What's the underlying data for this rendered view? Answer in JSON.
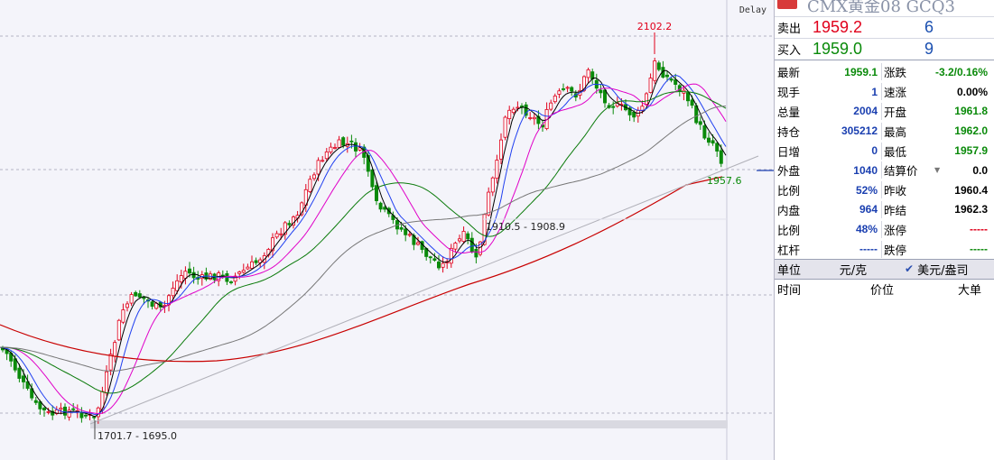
{
  "chart": {
    "delay_label": "Delay",
    "high_label": "2102.2",
    "current_label": "1957.6",
    "mid_range_label": "1910.5 - 1908.9",
    "low_range_label": "1701.7 - 1695.0",
    "colors": {
      "up": "#e0001b",
      "down": "#0a8a0a",
      "ma5": "#000000",
      "ma10": "#1f3ff0",
      "ma20": "#e000c8",
      "ma60": "#0a7a0a",
      "ma120": "#777777",
      "ma250": "#c80000"
    }
  },
  "quote": {
    "title": "CMX黄金08  GCQ3",
    "sell": {
      "label": "卖出",
      "price": "1959.2",
      "volume": "6"
    },
    "buy": {
      "label": "买入",
      "price": "1959.0",
      "volume": "9"
    },
    "stats": [
      {
        "k1": "最新",
        "v1": "1959.1",
        "c1": "green",
        "k2": "涨跌",
        "v2": "-3.2/0.16%",
        "c2": "green"
      },
      {
        "k1": "现手",
        "v1": "1",
        "c1": "blue",
        "k2": "速涨",
        "v2": "0.00%",
        "c2": "black"
      },
      {
        "k1": "总量",
        "v1": "2004",
        "c1": "blue",
        "k2": "开盘",
        "v2": "1961.8",
        "c2": "green"
      },
      {
        "k1": "持仓",
        "v1": "305212",
        "c1": "blue",
        "k2": "最高",
        "v2": "1962.0",
        "c2": "green"
      },
      {
        "k1": "日增",
        "v1": "0",
        "c1": "blue",
        "k2": "最低",
        "v2": "1957.9",
        "c2": "green"
      },
      {
        "k1": "外盘",
        "v1": "1040",
        "c1": "blue",
        "k2": "结算价",
        "v2": "0.0",
        "c2": "black"
      },
      {
        "k1": "比例",
        "v1": "52%",
        "c1": "blue",
        "k2": "昨收",
        "v2": "1960.4",
        "c2": "black"
      },
      {
        "k1": "内盘",
        "v1": "964",
        "c1": "blue",
        "k2": "昨结",
        "v2": "1962.3",
        "c2": "black"
      },
      {
        "k1": "比例",
        "v1": "48%",
        "c1": "blue",
        "k2": "涨停",
        "v2": "-----",
        "c2": "red"
      },
      {
        "k1": "杠杆",
        "v1": "-----",
        "c1": "blue",
        "k2": "跌停",
        "v2": "-----",
        "c2": "green"
      }
    ],
    "unit_label": "单位",
    "unit_value": "元/克",
    "unit_alt": "美元/盎司",
    "trade_headers": {
      "time": "时间",
      "price": "价位",
      "big": "大单"
    }
  }
}
